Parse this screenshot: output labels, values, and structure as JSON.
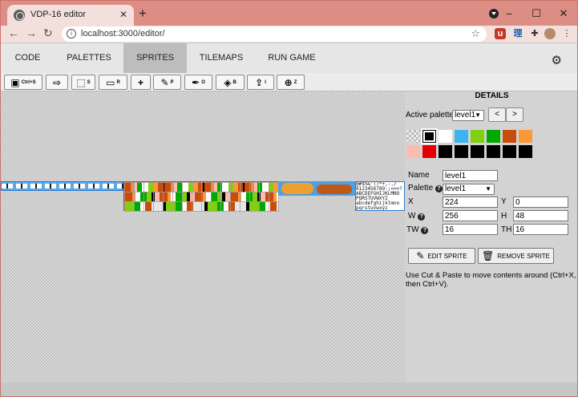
{
  "browser": {
    "tab_title": "VDP-16 editor",
    "url": "localhost:3000/editor/",
    "ext_labels": [
      "u",
      "理"
    ]
  },
  "menu": [
    {
      "label": "CODE",
      "active": false
    },
    {
      "label": "PALETTES",
      "active": false
    },
    {
      "label": "SPRITES",
      "active": true
    },
    {
      "label": "TILEMAPS",
      "active": false
    },
    {
      "label": "RUN GAME",
      "active": false
    }
  ],
  "toolbar": [
    {
      "icon": "save-icon",
      "glyph": "💾",
      "shortcut": "Ctrl+S"
    },
    {
      "icon": "export-icon",
      "glyph": "⇨",
      "shortcut": ""
    },
    {
      "icon": "select-icon",
      "glyph": "⬚",
      "shortcut": "S"
    },
    {
      "icon": "rect-select-icon",
      "glyph": "▭",
      "shortcut": "R"
    },
    {
      "icon": "add-icon",
      "glyph": "+",
      "shortcut": ""
    },
    {
      "icon": "pencil-icon",
      "glyph": "✎",
      "shortcut": "P"
    },
    {
      "icon": "eyedropper-icon",
      "glyph": "✒",
      "shortcut": "O"
    },
    {
      "icon": "fill-bucket-icon",
      "glyph": "◈",
      "shortcut": "B"
    },
    {
      "icon": "upload-icon",
      "glyph": "⇪",
      "shortcut": "I"
    },
    {
      "icon": "zoom-icon",
      "glyph": "⊕",
      "shortcut": "Z"
    }
  ],
  "details": {
    "title": "DETAILS",
    "active_palette_label": "Active palette",
    "active_palette_value": "level1",
    "prev_label": "<",
    "next_label": ">",
    "palette_colors": [
      "transparent",
      "#000000",
      "#ffffff",
      "#3cb4f0",
      "#80d010",
      "#00a800",
      "#c84c0c",
      "#fc9838",
      "#fcbcb0",
      "#e40000",
      "#000000",
      "#000000",
      "#000000",
      "#000000",
      "#000000",
      "#000000"
    ],
    "selected_color_index": 1,
    "name_label": "Name",
    "name_value": "level1",
    "palette_label": "Palette",
    "palette_value": "level1",
    "x_label": "X",
    "x_value": "224",
    "y_label": "Y",
    "y_value": "0",
    "w_label": "W",
    "w_value": "256",
    "h_label": "H",
    "h_value": "48",
    "tw_label": "TW",
    "tw_value": "16",
    "th_label": "TH",
    "th_value": "16",
    "edit_label": "EDIT SPRITE",
    "remove_label": "REMOVE SPRITE",
    "hint": "Use Cut & Paste to move contents around (Ctrl+X, then Ctrl+V)."
  },
  "sprite_sheet": {
    "font_rows": [
      "@#$%&'()*+,-./",
      "0123456789:;<=>?",
      "ABCDEFGHIJKLMNO",
      "PQRSTUVWXYZ",
      "abcdefghijklmno",
      "pqrstuvwxyz"
    ]
  }
}
